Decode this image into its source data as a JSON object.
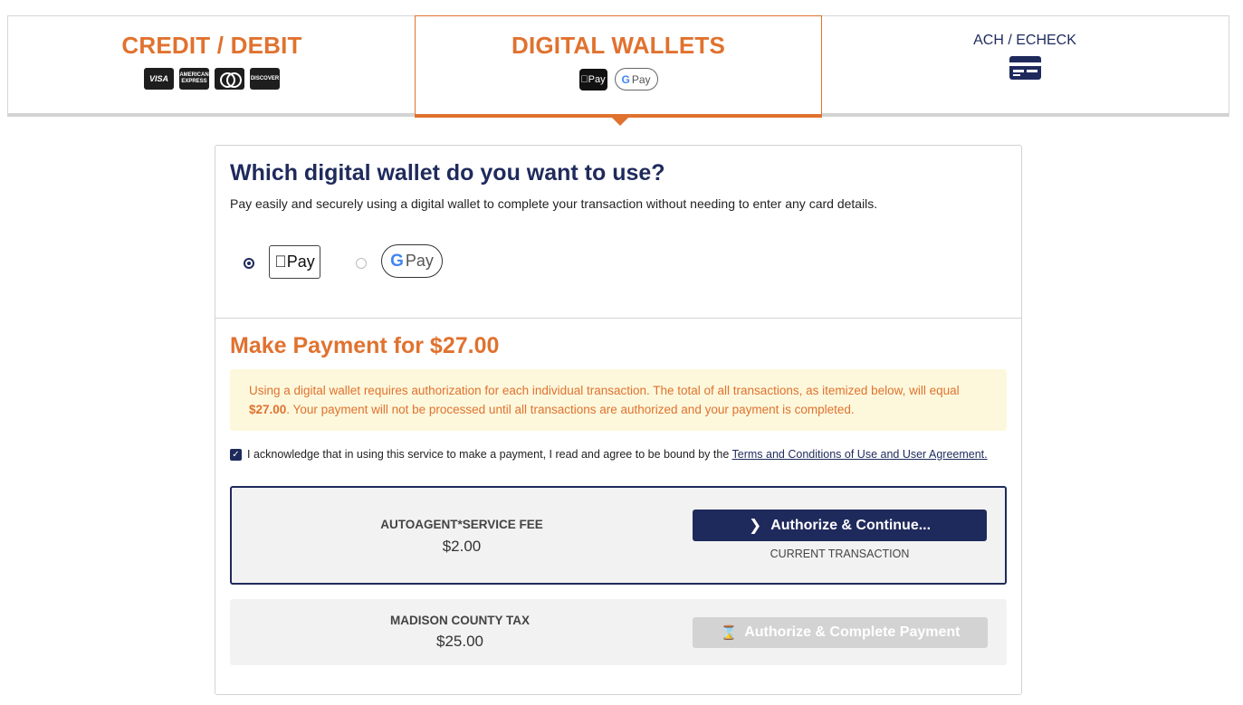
{
  "tabs": [
    {
      "label": "CREDIT / DEBIT",
      "logos": [
        "VISA",
        "AMERICAN EXPRESS",
        "mastercard",
        "DISCOVER"
      ]
    },
    {
      "label": "DIGITAL WALLETS",
      "logos": [
        "Pay",
        "Pay"
      ]
    },
    {
      "label": "ACH / ECHECK",
      "icon": "check-card-icon"
    }
  ],
  "wallet_section": {
    "title": "Which digital wallet do you want to use?",
    "subtitle": "Pay easily and securely using a digital wallet to complete your transaction without needing to enter any card details.",
    "options": [
      {
        "label": "Pay",
        "selected": true
      },
      {
        "label": "Pay",
        "selected": false
      }
    ]
  },
  "payment": {
    "title": "Make Payment for $27.00",
    "notice_before": "Using a digital wallet requires authorization for each individual transaction. The total of all transactions, as itemized below, will equal ",
    "notice_amount": "$27.00",
    "notice_after": ". Your payment will not be processed until all transactions are authorized and your payment is completed.",
    "ack_text": "I acknowledge that in using this service to make a payment, I read and agree to be bound by the ",
    "ack_link": "Terms and Conditions of Use and User Agreement.",
    "ack_checked": true
  },
  "transactions": [
    {
      "name": "AUTOAGENT*SERVICE FEE",
      "amount": "$2.00",
      "button": "Authorize & Continue...",
      "status": "CURRENT TRANSACTION"
    },
    {
      "name": "MADISON COUNTY TAX",
      "amount": "$25.00",
      "button": "Authorize & Complete Payment"
    }
  ],
  "colors": {
    "accent": "#e0722f",
    "navy": "#1f2a5c",
    "notice_bg": "#fdf8dc"
  }
}
